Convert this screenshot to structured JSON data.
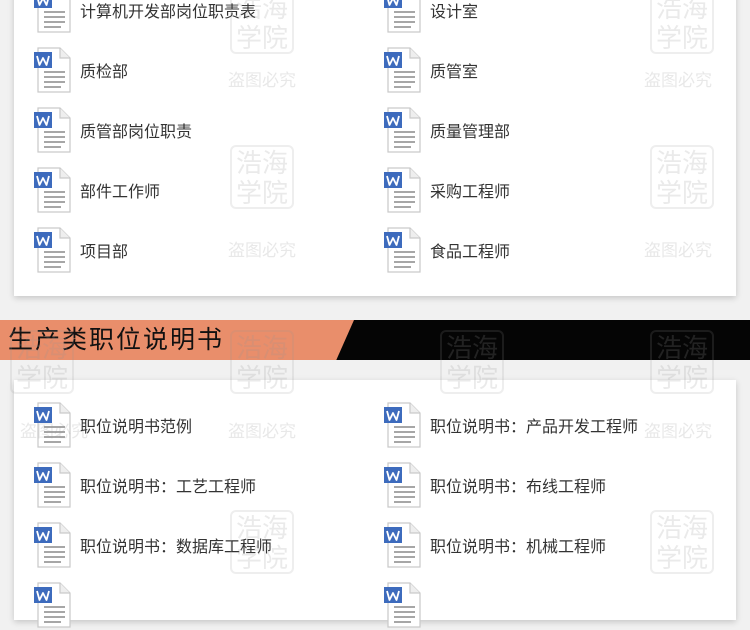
{
  "watermark": {
    "seal_top": "浩海",
    "seal_bottom": "学院",
    "notice": "盗图必究"
  },
  "top_files": [
    {
      "label": "计算机开发部岗位职责表",
      "icon": "word-doc-icon"
    },
    {
      "label": "设计室",
      "icon": "word-doc-icon"
    },
    {
      "label": "质检部",
      "icon": "word-doc-icon"
    },
    {
      "label": "质管室",
      "icon": "word-doc-icon"
    },
    {
      "label": "质管部岗位职责",
      "icon": "word-doc-icon"
    },
    {
      "label": "质量管理部",
      "icon": "word-doc-icon"
    },
    {
      "label": "部件工作师",
      "icon": "word-doc-icon"
    },
    {
      "label": "采购工程师",
      "icon": "word-doc-icon"
    },
    {
      "label": "项目部",
      "icon": "word-doc-icon"
    },
    {
      "label": "食品工程师",
      "icon": "word-doc-icon"
    }
  ],
  "section": {
    "title": "生产类职位说明书",
    "colors": {
      "accent": "#e98e6b",
      "bar": "#050505"
    }
  },
  "bottom_files": [
    {
      "label": "职位说明书范例",
      "icon": "word-doc-icon"
    },
    {
      "label": "职位说明书：产品开发工程师",
      "icon": "word-doc-icon"
    },
    {
      "label": "职位说明书：工艺工程师",
      "icon": "word-doc-icon"
    },
    {
      "label": "职位说明书：布线工程师",
      "icon": "word-doc-icon"
    },
    {
      "label": "职位说明书：数据库工程师",
      "icon": "word-doc-icon"
    },
    {
      "label": "职位说明书：机械工程师",
      "icon": "word-doc-icon"
    },
    {
      "label": "",
      "icon": "word-doc-icon"
    },
    {
      "label": "",
      "icon": "word-doc-icon"
    }
  ]
}
